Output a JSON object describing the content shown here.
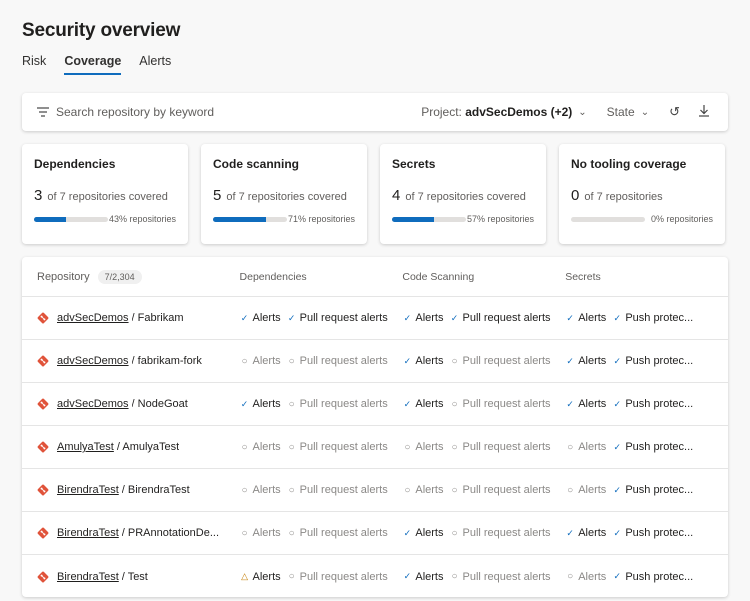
{
  "page": {
    "title": "Security overview"
  },
  "tabs": [
    {
      "label": "Risk",
      "active": false
    },
    {
      "label": "Coverage",
      "active": true
    },
    {
      "label": "Alerts",
      "active": false
    }
  ],
  "filter": {
    "search_placeholder": "Search repository by keyword",
    "project_label": "Project:",
    "project_value": "advSecDemos (+2)",
    "state_label": "State"
  },
  "cards": [
    {
      "title": "Dependencies",
      "count": "3",
      "text": "of 7 repositories covered",
      "percent": 43,
      "percent_label": "43% repositories"
    },
    {
      "title": "Code scanning",
      "count": "5",
      "text": "of 7 repositories covered",
      "percent": 71,
      "percent_label": "71% repositories"
    },
    {
      "title": "Secrets",
      "count": "4",
      "text": "of 7 repositories covered",
      "percent": 57,
      "percent_label": "57% repositories"
    },
    {
      "title": "No tooling coverage",
      "count": "0",
      "text": "of 7 repositories",
      "percent": 0,
      "percent_label": "0% repositories"
    }
  ],
  "table": {
    "columns": {
      "repository": "Repository",
      "count": "7/2,304",
      "dependencies": "Dependencies",
      "code_scanning": "Code Scanning",
      "secrets": "Secrets"
    },
    "rows": [
      {
        "project": "advSecDemos",
        "repo": "Fabrikam",
        "dep": [
          [
            "on",
            "Alerts"
          ],
          [
            "on",
            "Pull request alerts"
          ]
        ],
        "code": [
          [
            "on",
            "Alerts"
          ],
          [
            "on",
            "Pull request alerts"
          ]
        ],
        "sec": [
          [
            "on",
            "Alerts"
          ],
          [
            "on",
            "Push protec..."
          ]
        ]
      },
      {
        "project": "advSecDemos",
        "repo": "fabrikam-fork",
        "dep": [
          [
            "off",
            "Alerts"
          ],
          [
            "off",
            "Pull request alerts"
          ]
        ],
        "code": [
          [
            "on",
            "Alerts"
          ],
          [
            "off",
            "Pull request alerts"
          ]
        ],
        "sec": [
          [
            "on",
            "Alerts"
          ],
          [
            "on",
            "Push protec..."
          ]
        ]
      },
      {
        "project": "advSecDemos",
        "repo": "NodeGoat",
        "dep": [
          [
            "on",
            "Alerts"
          ],
          [
            "off",
            "Pull request alerts"
          ]
        ],
        "code": [
          [
            "on",
            "Alerts"
          ],
          [
            "off",
            "Pull request alerts"
          ]
        ],
        "sec": [
          [
            "on",
            "Alerts"
          ],
          [
            "on",
            "Push protec..."
          ]
        ]
      },
      {
        "project": "AmulyaTest",
        "repo": "AmulyaTest",
        "dep": [
          [
            "off",
            "Alerts"
          ],
          [
            "off",
            "Pull request alerts"
          ]
        ],
        "code": [
          [
            "off",
            "Alerts"
          ],
          [
            "off",
            "Pull request alerts"
          ]
        ],
        "sec": [
          [
            "off",
            "Alerts"
          ],
          [
            "on",
            "Push protec..."
          ]
        ]
      },
      {
        "project": "BirendraTest",
        "repo": "BirendraTest",
        "dep": [
          [
            "off",
            "Alerts"
          ],
          [
            "off",
            "Pull request alerts"
          ]
        ],
        "code": [
          [
            "off",
            "Alerts"
          ],
          [
            "off",
            "Pull request alerts"
          ]
        ],
        "sec": [
          [
            "off",
            "Alerts"
          ],
          [
            "on",
            "Push protec..."
          ]
        ]
      },
      {
        "project": "BirendraTest",
        "repo": "PRAnnotationDe...",
        "dep": [
          [
            "off",
            "Alerts"
          ],
          [
            "off",
            "Pull request alerts"
          ]
        ],
        "code": [
          [
            "on",
            "Alerts"
          ],
          [
            "off",
            "Pull request alerts"
          ]
        ],
        "sec": [
          [
            "on",
            "Alerts"
          ],
          [
            "on",
            "Push protec..."
          ]
        ]
      },
      {
        "project": "BirendraTest",
        "repo": "Test",
        "dep": [
          [
            "warn",
            "Alerts"
          ],
          [
            "off",
            "Pull request alerts"
          ]
        ],
        "code": [
          [
            "on",
            "Alerts"
          ],
          [
            "off",
            "Pull request alerts"
          ]
        ],
        "sec": [
          [
            "off",
            "Alerts"
          ],
          [
            "on",
            "Push protec..."
          ]
        ]
      }
    ]
  },
  "icons": {
    "filter": "filter-icon",
    "chevron": "chevron-down-icon",
    "refresh": "undo-icon",
    "download": "download-icon",
    "repo": "git-repo-icon",
    "on": "check-icon",
    "off": "circle-icon",
    "warn": "warning-triangle-icon"
  },
  "colors": {
    "accent": "#0f6cbd",
    "git": "#e0533a",
    "warning": "#c47c00"
  }
}
